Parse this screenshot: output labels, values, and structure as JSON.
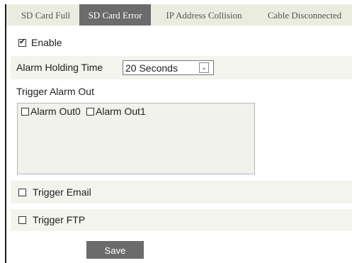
{
  "tabs": [
    {
      "label": "SD Card Full",
      "active": false
    },
    {
      "label": "SD Card Error",
      "active": true
    },
    {
      "label": "IP Address Collision",
      "active": false
    },
    {
      "label": "Cable Disconnected",
      "active": false
    }
  ],
  "enable": {
    "label": "Enable",
    "checked": true
  },
  "alarm_holding_time": {
    "label": "Alarm Holding Time",
    "selected": "20 Seconds"
  },
  "trigger_alarm_out": {
    "label": "Trigger Alarm Out",
    "options": [
      {
        "label": "Alarm Out0",
        "checked": false
      },
      {
        "label": "Alarm Out1",
        "checked": false
      }
    ]
  },
  "trigger_email": {
    "label": "Trigger Email",
    "checked": false
  },
  "trigger_ftp": {
    "label": "Trigger FTP",
    "checked": false
  },
  "save_label": "Save",
  "colors": {
    "tab_bar_bg": "#e9ecdf",
    "active_tab": "#6b6b6b",
    "row_shade": "#f3f4ee",
    "save_button": "#6b6b6b"
  }
}
